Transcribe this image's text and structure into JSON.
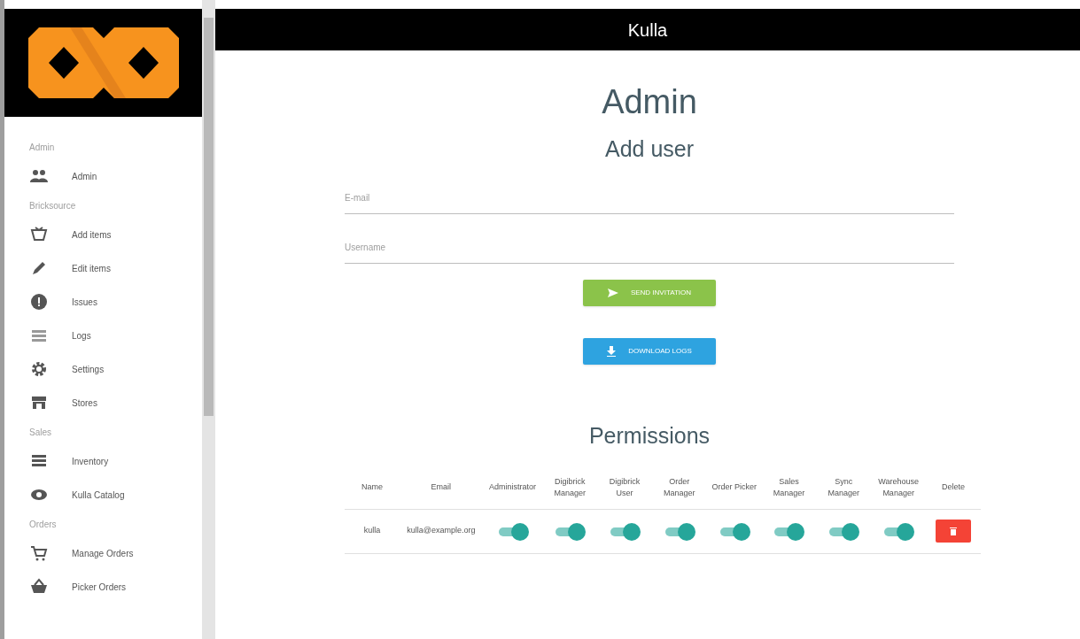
{
  "app_bar": {
    "title": "Kulla"
  },
  "sidebar": {
    "sections": [
      {
        "heading": "Admin",
        "items": [
          {
            "label": "Admin",
            "kind": "people"
          }
        ]
      },
      {
        "heading": "Bricksource",
        "items": [
          {
            "label": "Add items",
            "kind": "basket"
          },
          {
            "label": "Edit items",
            "kind": "pencil"
          },
          {
            "label": "Issues",
            "kind": "alert"
          },
          {
            "label": "Logs",
            "kind": "lines"
          },
          {
            "label": "Settings",
            "kind": "gear"
          },
          {
            "label": "Stores",
            "kind": "store"
          }
        ]
      },
      {
        "heading": "Sales",
        "items": [
          {
            "label": "Inventory",
            "kind": "list"
          },
          {
            "label": "Kulla Catalog",
            "kind": "eye"
          }
        ]
      },
      {
        "heading": "Orders",
        "items": [
          {
            "label": "Manage Orders",
            "kind": "cart"
          },
          {
            "label": "Picker Orders",
            "kind": "basket2"
          }
        ]
      }
    ]
  },
  "page": {
    "title": "Admin",
    "subtitle": "Add user",
    "fields": [
      {
        "placeholder": "E-mail"
      },
      {
        "placeholder": "Username"
      }
    ],
    "buttons": [
      {
        "label": "SEND INVITATION",
        "kind": "send"
      },
      {
        "label": "DOWNLOAD LOGS",
        "kind": "download"
      }
    ]
  },
  "permissions": {
    "title": "Permissions",
    "columns": [
      "Name",
      "Email",
      "Administrator",
      "Digibrick Manager",
      "Digibrick User",
      "Order Manager",
      "Order Picker",
      "Sales Manager",
      "Sync Manager",
      "Warehouse Manager",
      "Delete"
    ],
    "rows": [
      {
        "name": "kulla",
        "email": "kulla@example.org",
        "toggles": [
          true,
          true,
          true,
          true,
          true,
          true,
          true,
          true
        ]
      }
    ]
  }
}
